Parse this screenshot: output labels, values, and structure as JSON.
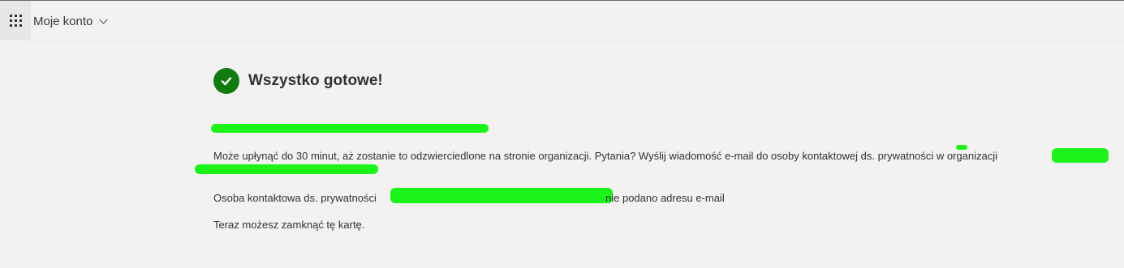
{
  "header": {
    "app_title": "Moje konto",
    "waffle_icon": "app-launcher-icon",
    "dropdown_icon": "chevron-down-icon"
  },
  "main": {
    "status_icon": "check-circle-icon",
    "title": "Wszystko gotowe!",
    "line_delay": "Może upłynąć do 30 minut, aż zostanie to odzwierciedlone na stronie organizacji. Pytania? Wyślij wiadomość e-mail do osoby kontaktowej ds. prywatności w organizacji",
    "contact_label": "Osoba kontaktowa ds. prywatności",
    "contact_email_missing": "nie podano adresu e-mail",
    "close_hint": "Teraz możesz zamknąć tę kartę."
  },
  "colors": {
    "success_green": "#107c10",
    "background": "#f3f2f1",
    "redaction_green": "#1cf319"
  }
}
